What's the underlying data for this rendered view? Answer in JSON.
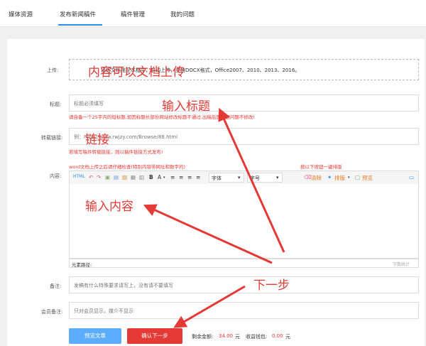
{
  "nav": {
    "tabs": [
      "媒体资源",
      "发布新闻稿件",
      "稿件管理",
      "我的问题"
    ]
  },
  "form": {
    "upload": {
      "label": "上传:",
      "text": "请将文档拖至本框中，自动上传，支持DOCX格式，Office2007、2010、2013、2016。"
    },
    "title": {
      "label": "标题:",
      "placeholder": "标题必须填写",
      "hint": "请自备一个25字内的短标题,如因标题长部份网站修改标题不通过,出稿后因标题问题不修改!"
    },
    "link": {
      "label": "转载链接:",
      "placeholder": "例：http://www.rwjzy.com/Browse/88.html",
      "hint": "若填写稿件转载链接，则以稿件链接方式发布!"
    },
    "content": {
      "label": "内容:",
      "hint_left": "word文档上传之后请仔细检查(特别内容带网址和数字的)",
      "hint_right": "按以下按钮一键排版",
      "font": "字体",
      "size": "字号",
      "clear": "清除",
      "layout": "排版",
      "preview": "预览",
      "path_label": "元素路径:",
      "wordcount": "字数统计"
    },
    "remark": {
      "label": "备注:",
      "placeholder": "发稿有什么特殊要求请写上，没有请不要填写"
    },
    "member_remark": {
      "label": "会员备注:",
      "placeholder": "只对会员显示，媒介不显示"
    }
  },
  "actions": {
    "preview": "预览文章",
    "next": "确认下一步",
    "balance_label": "剩余金额:",
    "balance": "34.00",
    "unit1": "元",
    "wallet_label": "收益钱包:",
    "wallet": "0.00",
    "unit2": "元"
  },
  "annotations": {
    "upload": "内容可以文档上传",
    "title": "输入标题",
    "link": "链接",
    "content": "输入内容",
    "next": "下一步"
  },
  "colors": {
    "accent": "#2d8cf0",
    "red": "#e53935",
    "preview_btn": "#5cadff",
    "next_btn": "#e53935"
  }
}
